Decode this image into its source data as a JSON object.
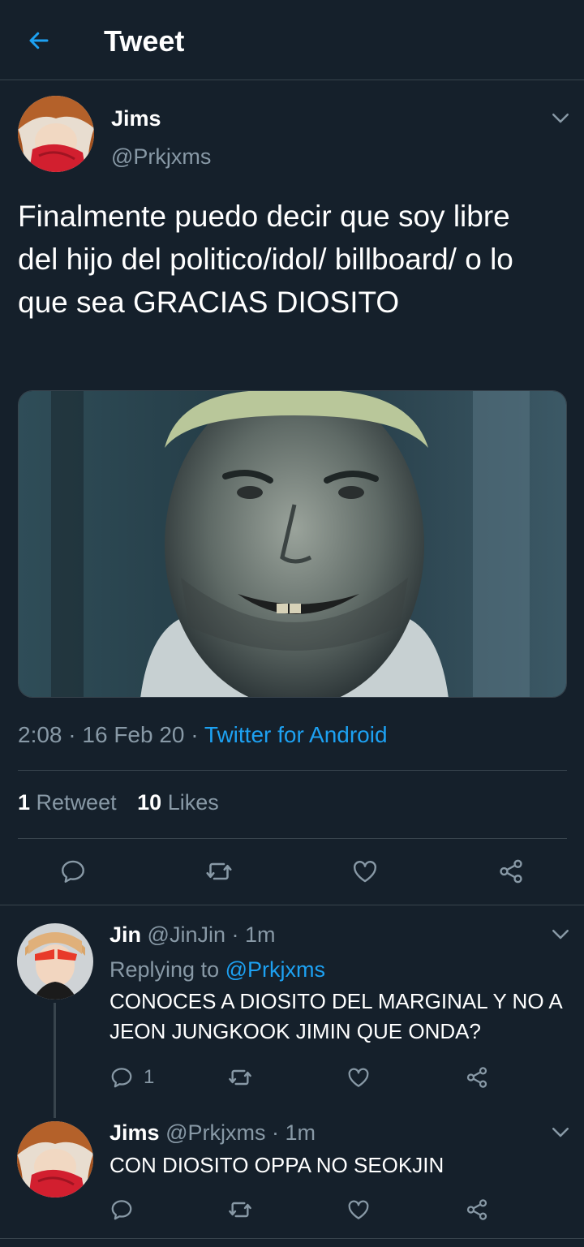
{
  "header": {
    "title": "Tweet"
  },
  "tweet": {
    "author_name": "Jims",
    "author_handle": "@Prkjxms",
    "text": "Finalmente puedo decir que soy libre del hijo del politico/idol/ billboard/ o lo que sea GRACIAS DIOSITO",
    "time": "2:08",
    "date": "16 Feb 20",
    "source": "Twitter for Android",
    "retweets_count": "1",
    "retweets_label": "Retweet",
    "likes_count": "10",
    "likes_label": "Likes"
  },
  "replies": [
    {
      "name": "Jin",
      "handle": "@JinJin",
      "time": "1m",
      "replying_prefix": "Replying to",
      "replying_to": "@Prkjxms",
      "text": "CONOCES A DIOSITO DEL MARGINAL Y NO A JEON JUNGKOOK JIMIN QUE ONDA?",
      "reply_count": "1"
    },
    {
      "name": "Jims",
      "handle": "@Prkjxms",
      "time": "1m",
      "text": "CON DIOSITO OPPA NO SEOKJIN"
    }
  ],
  "separator": "·",
  "colors": {
    "background": "#15202b",
    "accent": "#1da1f2",
    "muted": "#8899a6",
    "border": "#38444d"
  },
  "icons": [
    "back-arrow-icon",
    "chevron-down-icon",
    "reply-icon",
    "retweet-icon",
    "like-icon",
    "share-icon"
  ]
}
